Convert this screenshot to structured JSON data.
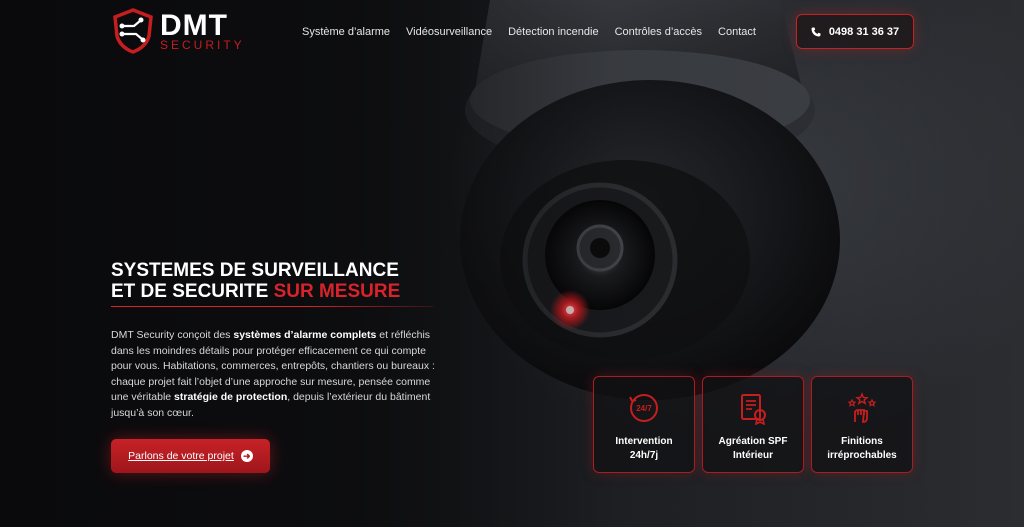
{
  "brand": {
    "name": "DMT",
    "tagline": "SECURITY",
    "accent_color": "#d8232a"
  },
  "nav": {
    "items": [
      {
        "label": "Système d’alarme"
      },
      {
        "label": "Vidéosurveillance"
      },
      {
        "label": "Détection incendie"
      },
      {
        "label": "Contrôles d’accès"
      },
      {
        "label": "Contact"
      }
    ]
  },
  "header": {
    "phone_label": "0498 31 36 37",
    "phone_icon": "phone-icon"
  },
  "hero": {
    "title_line1": "SYSTEMES DE SURVEILLANCE",
    "title_line2": "ET DE SECURITE ",
    "title_accent": "SUR MESURE",
    "desc_part1": "DMT Security conçoit des ",
    "desc_bold1": "systèmes d’alarme complets",
    "desc_part2": " et réfléchis dans les moindres détails pour protéger efficacement ce qui compte pour vous. Habitations, commerces, entrepôts, chantiers ou bureaux : chaque projet fait l’objet d’une approche sur mesure, pensée comme une véritable ",
    "desc_bold2": "stratégie de protection",
    "desc_part3": ", depuis l’extérieur du bâtiment jusqu’à son cœur.",
    "cta_label": "Parlons de votre projet",
    "cta_icon": "arrow-right-icon"
  },
  "features": [
    {
      "icon": "clock-24-7-icon",
      "icon_text": "24/7",
      "line1": "Intervention",
      "line2": "24h/7j"
    },
    {
      "icon": "certificate-icon",
      "line1": "Agréation SPF",
      "line2": "Intérieur"
    },
    {
      "icon": "hand-stars-icon",
      "line1": "Finitions",
      "line2": "irréprochables"
    }
  ]
}
